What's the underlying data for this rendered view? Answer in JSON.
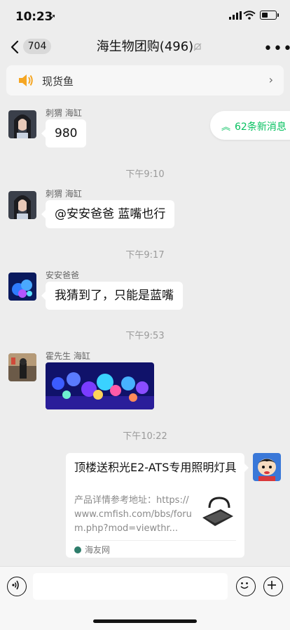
{
  "status": {
    "time": "10:23"
  },
  "header": {
    "back_count": "704",
    "title": "海生物团购(496)"
  },
  "notice": {
    "text": "现货鱼"
  },
  "new_messages": {
    "label": "62条新消息"
  },
  "messages": [
    {
      "sender": "刺猬 海缸",
      "text": "980"
    },
    {
      "time": "下午9:10"
    },
    {
      "sender": "刺猬 海缸",
      "text": "@安安爸爸 蓝嘴也行"
    },
    {
      "time": "下午9:17"
    },
    {
      "sender": "安安爸爸",
      "text": "我猜到了，只能是蓝嘴"
    },
    {
      "time": "下午9:53"
    },
    {
      "sender": "霍先生 海缸"
    },
    {
      "time": "下午10:22"
    }
  ],
  "card": {
    "title": "顶楼送积光E2-ATS专用照明灯具",
    "desc": "产品详情参考地址：https://www.cmfish.com/bbs/forum.php?mod=viewthr...",
    "source": "海友网"
  },
  "icons": {
    "back": "chevron-left-icon",
    "mute": "bell-off-icon",
    "more": "more-dots-icon",
    "speaker": "speaker-icon",
    "voice": "voice-icon",
    "emoji": "emoji-icon",
    "plus": "plus-icon"
  },
  "colors": {
    "accent": "#07c160",
    "notice_icon": "#f5a623",
    "background": "#ededed"
  }
}
